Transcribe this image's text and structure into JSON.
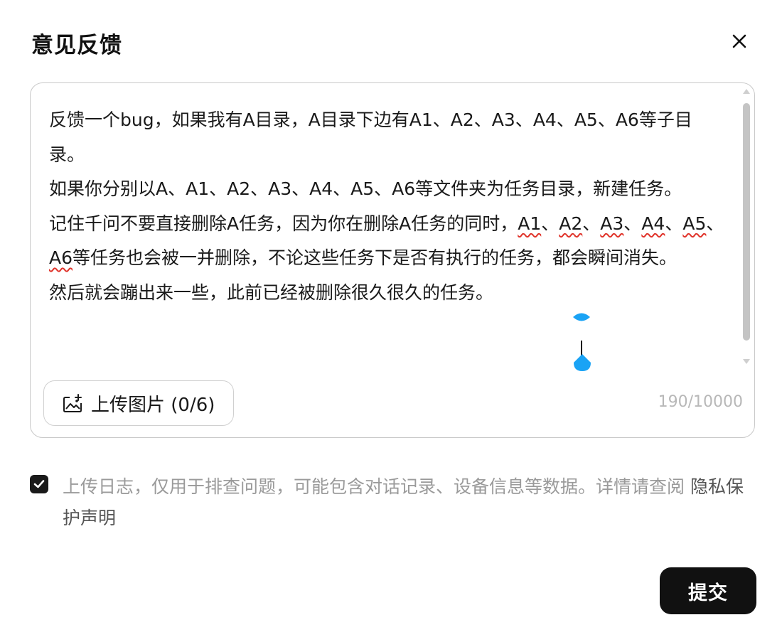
{
  "dialog": {
    "title": "意见反馈",
    "close_icon": "close-icon"
  },
  "editor": {
    "paragraphs": [
      {
        "segments": [
          {
            "text": "反馈一个bug，如果我有A目录，A目录下边有A1、A2、A3、A4、A5、A6等子目录。"
          }
        ]
      },
      {
        "segments": [
          {
            "text": "如果你分别以A、A1、A2、A3、A4、A5、A6等文件夹为任务目录，新建任务。"
          }
        ]
      },
      {
        "segments": [
          {
            "text": "记住千问不要直接删除A任务，因为你在删除A任务的同时，"
          },
          {
            "text": "A1",
            "spellcheck": true
          },
          {
            "text": "、"
          },
          {
            "text": "A2",
            "spellcheck": true
          },
          {
            "text": "、"
          },
          {
            "text": "A3",
            "spellcheck": true
          },
          {
            "text": "、"
          },
          {
            "text": "A4",
            "spellcheck": true
          },
          {
            "text": "、"
          },
          {
            "text": "A5",
            "spellcheck": true
          },
          {
            "text": "、"
          },
          {
            "text": "A6",
            "spellcheck": true
          },
          {
            "text": "等任务也会被一并删除，不论这些任务下是否有执行的任务，都会瞬间消失。"
          }
        ]
      },
      {
        "segments": [
          {
            "text": "然后就会蹦出来一些，此前已经被删除很久很久的任务。"
          }
        ]
      }
    ],
    "upload_label": "上传图片 (0/6)",
    "upload_icon": "image-upload-icon",
    "char_count": "190/10000"
  },
  "consent": {
    "checked": true,
    "text": "上传日志，仅用于排查问题，可能包含对话记录、设备信息等数据。详情请查阅 ",
    "link": "隐私保护声明"
  },
  "actions": {
    "submit_label": "提交"
  },
  "colors": {
    "caret_handle": "#1aa3f5",
    "submit_bg": "#111111",
    "spellcheck": "#e0342b"
  }
}
